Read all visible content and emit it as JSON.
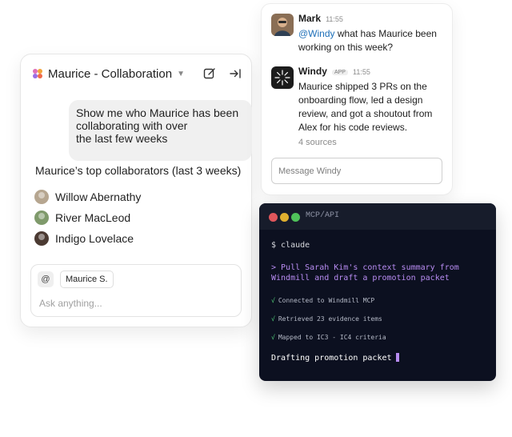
{
  "collab_panel": {
    "title": "Maurice - Collaboration",
    "user_message": "Show me who Maurice has been\ncollaborating with over\nthe last few weeks",
    "summary": "Maurice’s top collaborators (last 3 weeks)",
    "collaborators": [
      {
        "name": "Willow Abernathy",
        "avatar_color": "#b6a690"
      },
      {
        "name": "River MacLeod",
        "avatar_color": "#7f9a6b"
      },
      {
        "name": "Indigo Lovelace",
        "avatar_color": "#4b3a32"
      }
    ],
    "input": {
      "at_label": "@",
      "mention_chip": "Maurice S.",
      "placeholder": "Ask anything..."
    }
  },
  "slack_panel": {
    "messages": [
      {
        "author": "Mark",
        "time": "11:55",
        "mention": "@Windy",
        "text": " what has Maurice been working on this week?"
      },
      {
        "author": "Windy",
        "badge": "APP",
        "time": "11:55",
        "text": "Maurice shipped 3 PRs on the onboarding flow, led a design review, and got a shoutout from Alex for his code reviews.",
        "sources": "4 sources"
      }
    ],
    "input_placeholder": "Message Windy"
  },
  "terminal": {
    "title": "MCP/API",
    "prompt": "$ claude",
    "command": "> Pull Sarah Kim's context summary from\nWindmill and draft a promotion packet",
    "steps": [
      "Connected to Windmill MCP",
      "Retrieved 23 evidence items",
      "Mapped to IC3 - IC4 criteria"
    ],
    "check_symbol": "√",
    "status": "Drafting promotion packet",
    "colors": {
      "dot_red": "#e0565b",
      "dot_yellow": "#e0b02f",
      "dot_green": "#4fc25a"
    }
  }
}
